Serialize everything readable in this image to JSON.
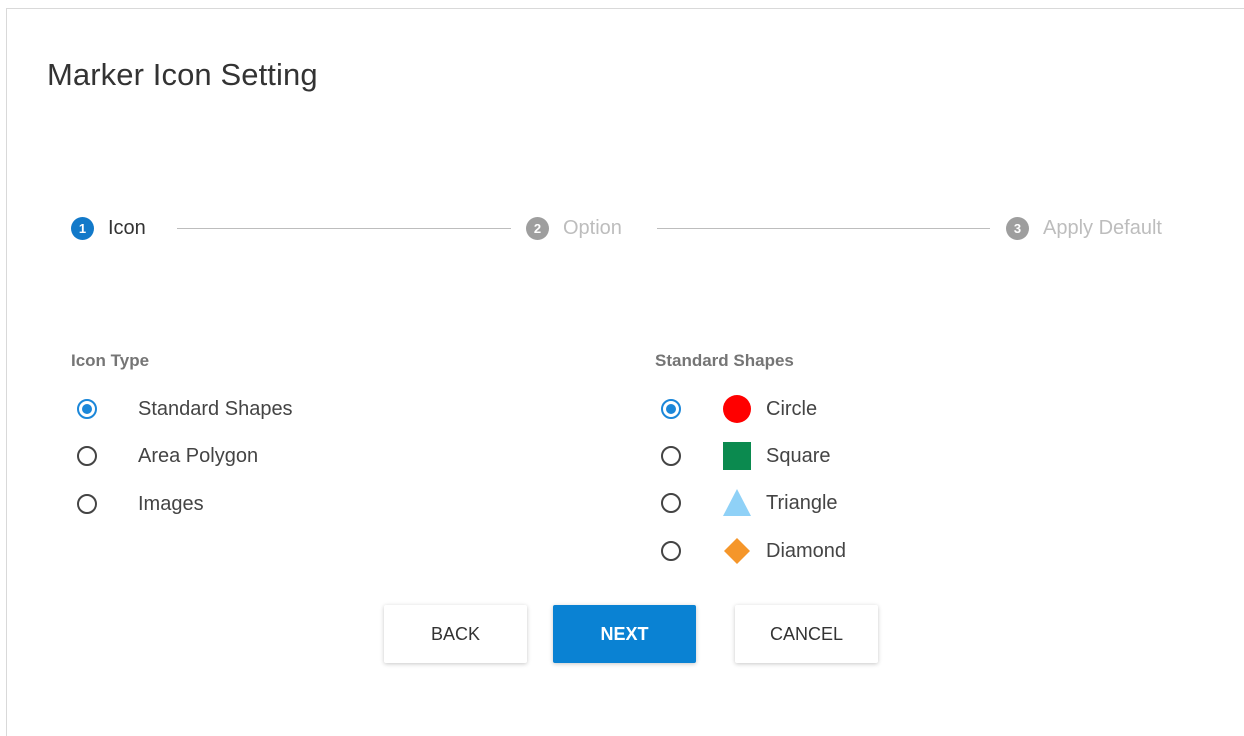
{
  "dialog": {
    "title": "Marker Icon Setting"
  },
  "stepper": {
    "steps": [
      {
        "number": "1",
        "label": "Icon",
        "active": true
      },
      {
        "number": "2",
        "label": "Option",
        "active": false
      },
      {
        "number": "3",
        "label": "Apply Default",
        "active": false
      }
    ]
  },
  "icon_type": {
    "heading": "Icon Type",
    "options": [
      {
        "label": "Standard Shapes",
        "checked": true
      },
      {
        "label": "Area Polygon",
        "checked": false
      },
      {
        "label": "Images",
        "checked": false
      }
    ]
  },
  "standard_shapes": {
    "heading": "Standard Shapes",
    "options": [
      {
        "label": "Circle",
        "checked": true,
        "icon": "circle-icon",
        "color": "#ff0000"
      },
      {
        "label": "Square",
        "checked": false,
        "icon": "square-icon",
        "color": "#0b8a4f"
      },
      {
        "label": "Triangle",
        "checked": false,
        "icon": "triangle-icon",
        "color": "#8fd1f7"
      },
      {
        "label": "Diamond",
        "checked": false,
        "icon": "diamond-icon",
        "color": "#f5962a"
      }
    ]
  },
  "buttons": {
    "back": "BACK",
    "next": "NEXT",
    "cancel": "CANCEL"
  },
  "colors": {
    "accent": "#0a82d3",
    "inactive_step": "#9e9e9e"
  }
}
